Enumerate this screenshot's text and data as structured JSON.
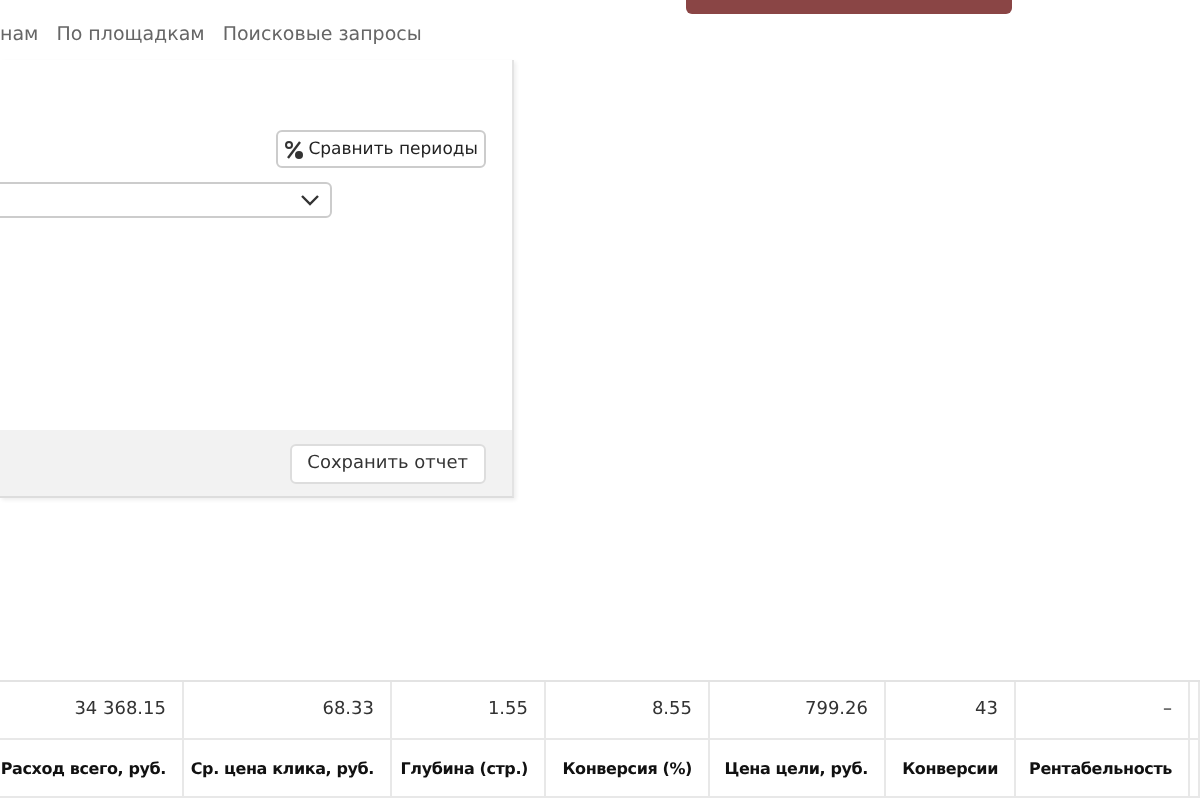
{
  "tabs": [
    {
      "label": "нам"
    },
    {
      "label": "По площадкам"
    },
    {
      "label": "Поисковые запросы"
    }
  ],
  "panel": {
    "compare_button": "Сравнить периоды",
    "save_button": "Сохранить отчет"
  },
  "table": {
    "columns": [
      "Расход всего, руб.",
      "Ср. цена клика, руб.",
      "Глубина (стр.)",
      "Конверсия (%)",
      "Цена цели, руб.",
      "Конверсии",
      "Рентабельность"
    ],
    "totals": [
      "34 368.15",
      "68.33",
      "1.55",
      "8.55",
      "799.26",
      "43",
      "–"
    ]
  }
}
